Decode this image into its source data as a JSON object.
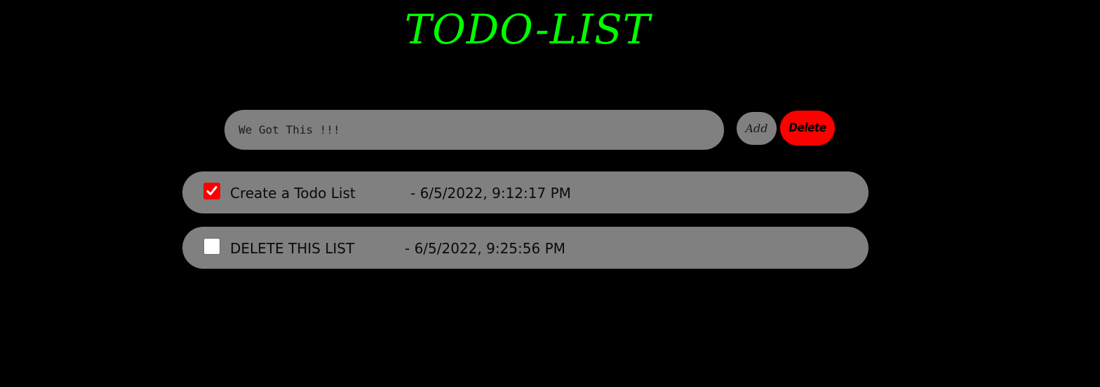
{
  "header": {
    "title": "TODO-LIST",
    "title_color": "#00ff00"
  },
  "input": {
    "value": "",
    "placeholder": "We Got This !!!"
  },
  "buttons": {
    "add_label": "Add",
    "delete_label": "Delete",
    "delete_color": "#ff0000"
  },
  "todos": [
    {
      "text": "Create a Todo List",
      "date": "- 6/5/2022, 9:12:17 PM",
      "checked": true
    },
    {
      "text": "DELETE THIS LIST",
      "date": "- 6/5/2022, 9:25:56 PM",
      "checked": false
    }
  ],
  "icons": {
    "checkmark": "check-icon"
  }
}
